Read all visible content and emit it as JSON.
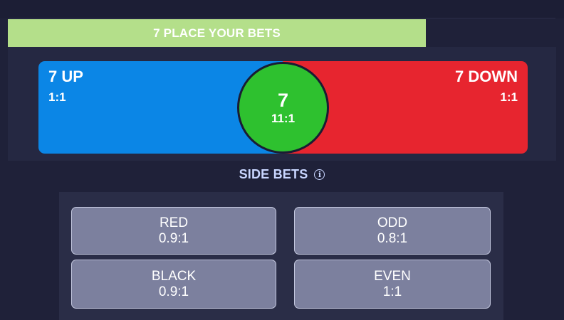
{
  "banner": {
    "text": "7 PLACE YOUR BETS"
  },
  "main_bets": {
    "up": {
      "label": "7 UP",
      "odds": "1:1",
      "color": "#0b86e6"
    },
    "seven": {
      "label": "7",
      "odds": "11:1",
      "color": "#2ec12f"
    },
    "down": {
      "label": "7 DOWN",
      "odds": "1:1",
      "color": "#e7252f"
    }
  },
  "side_bets": {
    "title": "SIDE BETS",
    "info_icon": "info-icon",
    "items": [
      {
        "label": "RED",
        "odds": "0.9:1"
      },
      {
        "label": "ODD",
        "odds": "0.8:1"
      },
      {
        "label": "BLACK",
        "odds": "0.9:1"
      },
      {
        "label": "EVEN",
        "odds": "1:1"
      }
    ]
  },
  "colors": {
    "background": "#1f2139",
    "banner": "#b4df8a",
    "side_button": "#7c809e",
    "heading": "#c9d6ff"
  }
}
